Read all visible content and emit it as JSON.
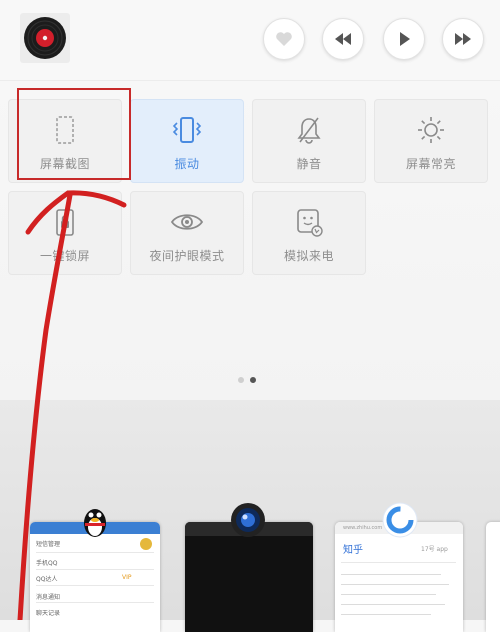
{
  "media": {
    "icons": [
      "vinyl-record-icon",
      "heart-icon",
      "previous-icon",
      "play-icon",
      "next-icon"
    ]
  },
  "quick_settings": {
    "tiles": [
      {
        "label": "屏幕截图",
        "icon": "screenshot-icon",
        "active": false
      },
      {
        "label": "振动",
        "icon": "vibrate-icon",
        "active": true
      },
      {
        "label": "静音",
        "icon": "mute-bell-icon",
        "active": false
      },
      {
        "label": "屏幕常亮",
        "icon": "brightness-icon",
        "active": false
      },
      {
        "label": "一键锁屏",
        "icon": "lock-icon",
        "active": false
      },
      {
        "label": "夜间护眼模式",
        "icon": "eye-icon",
        "active": false
      },
      {
        "label": "模拟来电",
        "icon": "fake-call-icon",
        "active": false
      }
    ],
    "page_indicator": {
      "pages": 2,
      "current": 2
    }
  },
  "recent_apps": {
    "qq": {
      "rows": [
        "短信管理",
        "手机QQ",
        "QQ达人",
        "消息通知",
        "聊天记录"
      ],
      "badge": "VIP"
    },
    "zhihu": {
      "title": "知乎",
      "url": "www.zhihu.com",
      "tab": "17号 app"
    }
  },
  "colors": {
    "accent": "#4a8be0",
    "annotation": "#d22020",
    "dot_inactive": "#cfcfcf",
    "dot_active": "#555555"
  }
}
